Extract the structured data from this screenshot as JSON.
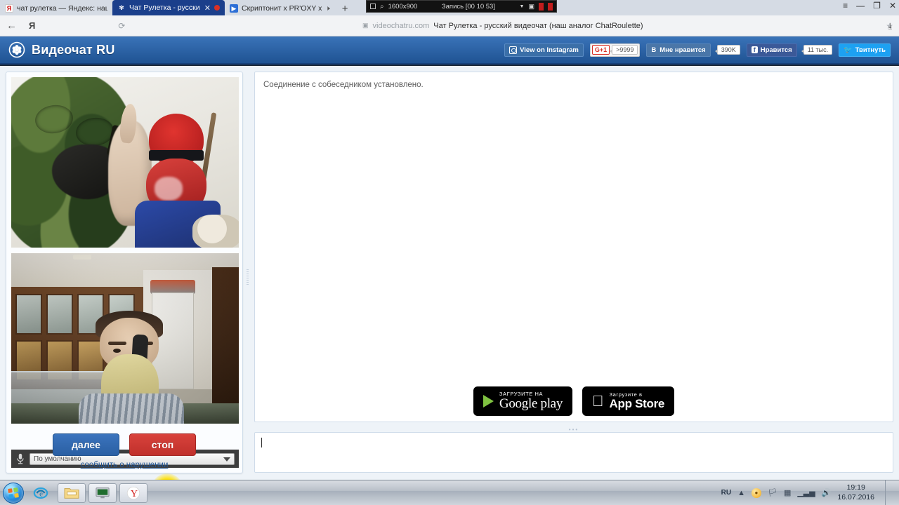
{
  "browser": {
    "tabs": [
      {
        "title": "чат рулетка — Яндекс: наш",
        "favicon": "yandex-icon",
        "active": false
      },
      {
        "title": "Чат Рулетка - русски",
        "favicon": "videochat-icon",
        "active": true
      },
      {
        "title": "Скриптонит x PR'OXY x",
        "favicon": "youtube-icon",
        "active": false
      }
    ],
    "new_tab_label": "+",
    "back_label": "←",
    "yandex_label": "Я",
    "reload_label": "⟳",
    "star_label": "★",
    "download_label": "⤓",
    "window": {
      "menu": "≡",
      "minimize": "—",
      "restore": "❐",
      "close": "✕"
    },
    "omnibox": {
      "lock": "🔒",
      "host": "videochatru.com",
      "title": "Чат Рулетка - русский видеочат (наш аналог ChatRoulette)"
    }
  },
  "recorder": {
    "resolution": "1600x900",
    "status": "Запись [00 10 53]",
    "window_icon": "window-icon",
    "zoom_icon": "magnifier-icon",
    "caret_icon": "chevron-down-icon",
    "camera_icon": "camera-icon",
    "stop_icon": "stop-record-icon",
    "record_icon": "record-icon"
  },
  "site": {
    "brand": "Видеочат RU",
    "logo_name": "videochat-flower-logo",
    "social": {
      "instagram": "View on Instagram",
      "gplus_label": "G+1",
      "gplus_count": ">9999",
      "vk_label": "В",
      "vk_text": "Мне нравится",
      "vk_count": "390K",
      "fb_label": "f",
      "fb_text": "Нравится",
      "fb_count": "11 тыс.",
      "twitter_text": "Твитнуть"
    }
  },
  "video": {
    "remote_name": "remote-video",
    "local_name": "local-video",
    "mic_icon": "microphone-icon",
    "mic_device": "По умолчанию"
  },
  "controls": {
    "next": "далее",
    "stop": "стоп",
    "report": "сообщить о нарушении"
  },
  "chat": {
    "system_message": "Соединение с собеседником установлено.",
    "input_value": "",
    "input_placeholder": "",
    "grip": "•••"
  },
  "stores": {
    "google": {
      "small": "ЗАГРУЗИТЕ НА",
      "big": "Google play"
    },
    "apple": {
      "small": "Загрузите в",
      "big": "App Store"
    }
  },
  "taskbar": {
    "start_name": "start-orb",
    "items": [
      {
        "name": "taskbar-internet-explorer",
        "icon": "ie-icon"
      },
      {
        "name": "taskbar-explorer",
        "icon": "folder-icon"
      },
      {
        "name": "taskbar-screen-recorder",
        "icon": "monitor-icon"
      },
      {
        "name": "taskbar-yandex-browser",
        "icon": "yandex-icon"
      }
    ],
    "tray": {
      "language": "RU",
      "show_hidden": "▲",
      "time": "19:19",
      "date": "16.07.2016"
    }
  }
}
